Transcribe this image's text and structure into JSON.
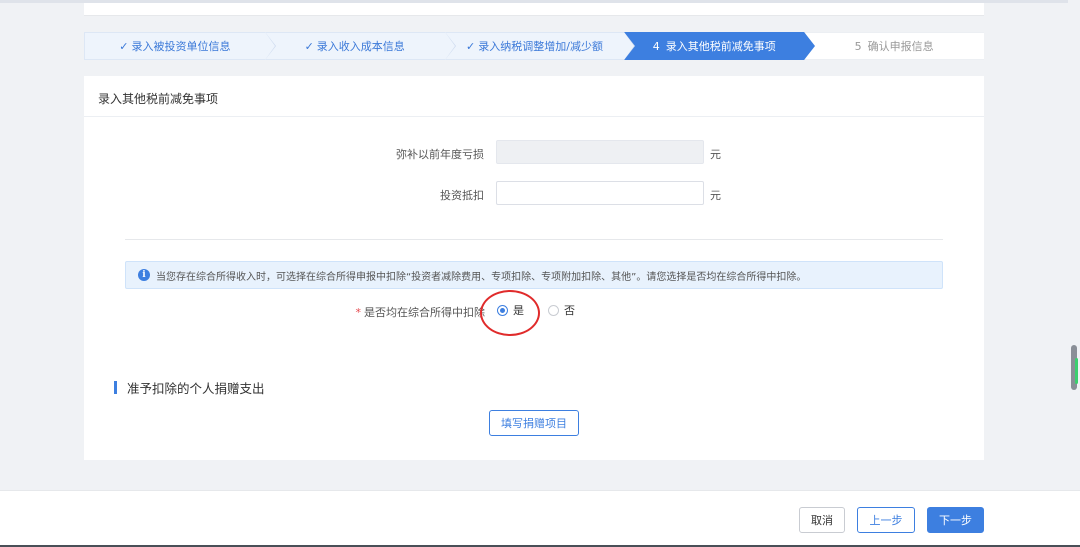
{
  "steps": [
    {
      "label": "录入被投资单位信息",
      "marker": "✓",
      "state": "done"
    },
    {
      "label": "录入收入成本信息",
      "marker": "✓",
      "state": "done"
    },
    {
      "label": "录入纳税调整增加/减少额",
      "marker": "✓",
      "state": "done"
    },
    {
      "label": "录入其他税前减免事项",
      "marker": "4",
      "state": "active"
    },
    {
      "label": "确认申报信息",
      "marker": "5",
      "state": "todo"
    }
  ],
  "card": {
    "title": "录入其他税前减免事项",
    "loss_label": "弥补以前年度亏损",
    "loss_value": "",
    "loss_unit": "元",
    "invest_label": "投资抵扣",
    "invest_value": "",
    "invest_unit": "元",
    "notice": "当您存在综合所得收入时，可选择在综合所得申报中扣除“投资者减除费用、专项扣除、专项附加扣除、其他”。请您选择是否均在综合所得中扣除。",
    "radio_question": "是否均在综合所得中扣除",
    "radio_yes": "是",
    "radio_no": "否",
    "radio_selected": "是",
    "section_title": "准予扣除的个人捐赠支出",
    "donation_button": "填写捐赠项目"
  },
  "footer": {
    "cancel": "取消",
    "prev": "上一步",
    "next": "下一步"
  },
  "colors": {
    "primary": "#3d7fe0",
    "annotation": "#e02b2b",
    "required": "#e5484d"
  }
}
